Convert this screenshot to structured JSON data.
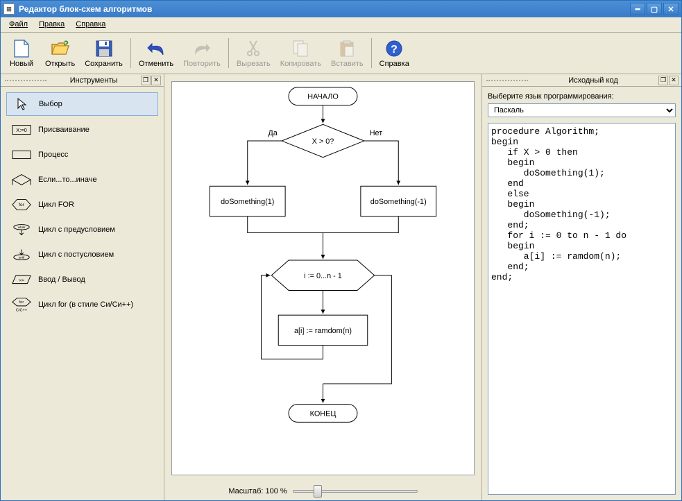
{
  "window": {
    "title": "Редактор блок-схем алгоритмов"
  },
  "menu": {
    "file": "Файл",
    "edit": "Правка",
    "help": "Справка"
  },
  "toolbar": {
    "new": "Новый",
    "open": "Открыть",
    "save": "Сохранить",
    "undo": "Отменить",
    "redo": "Повторить",
    "cut": "Вырезать",
    "copy": "Копировать",
    "paste": "Вставить",
    "help": "Справка"
  },
  "panels": {
    "tools_title": "Инструменты",
    "code_title": "Исходный код"
  },
  "tools": {
    "select": "Выбор",
    "assign": "Присваивание",
    "process": "Процесс",
    "ifelse": "Если...то...иначе",
    "for": "Цикл FOR",
    "while": "Цикл с предусловием",
    "until": "Цикл с постусловием",
    "io": "Ввод / Вывод",
    "cfor": "Цикл for (в стиле Си/Си++)"
  },
  "flowchart": {
    "start": "НАЧАЛО",
    "cond": "X > 0?",
    "yes": "Да",
    "no": "Нет",
    "left_proc": "doSomething(1)",
    "right_proc": "doSomething(-1)",
    "loop": "i := 0...n - 1",
    "loop_body": "a[i] := ramdom(n)",
    "end": "КОНЕЦ"
  },
  "status": {
    "zoom_label": "Масштаб: 100 %"
  },
  "code": {
    "lang_label": "Выберите язык программирования:",
    "lang_value": "Паскаль",
    "source": "procedure Algorithm;\nbegin\n   if X > 0 then\n   begin\n      doSomething(1);\n   end\n   else\n   begin\n      doSomething(-1);\n   end;\n   for i := 0 to n - 1 do\n   begin\n      a[i] := ramdom(n);\n   end;\nend;"
  }
}
